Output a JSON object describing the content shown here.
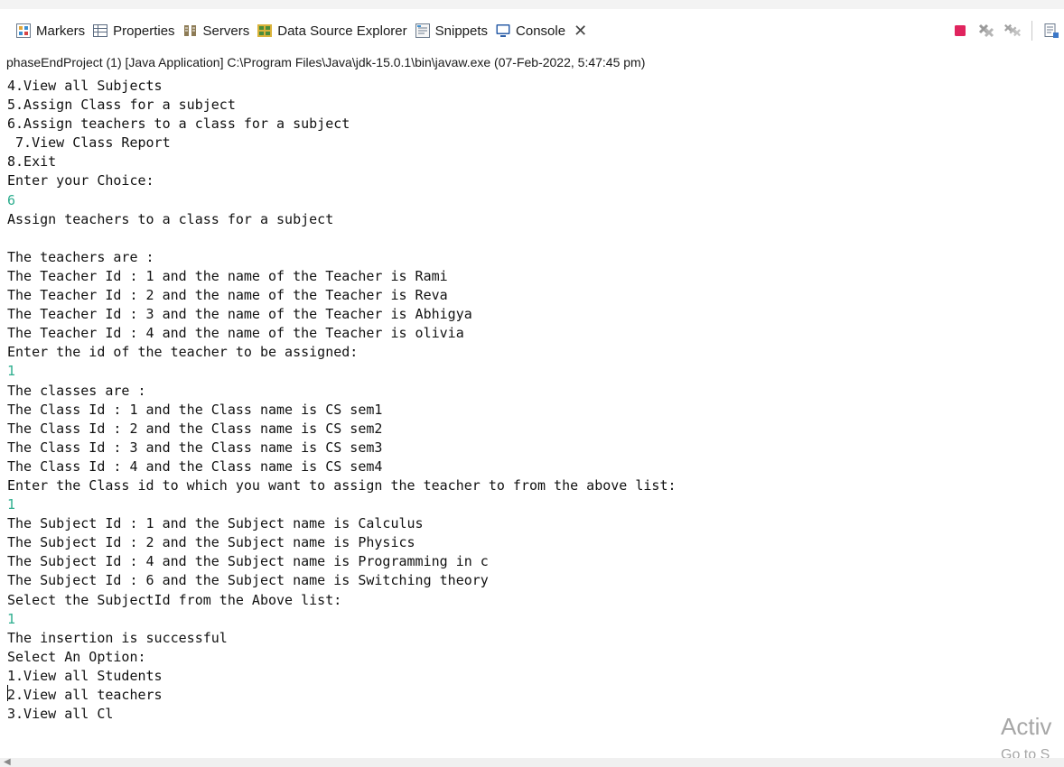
{
  "tabs": [
    {
      "id": "markers",
      "label": "Markers",
      "icon": "markers-icon"
    },
    {
      "id": "properties",
      "label": "Properties",
      "icon": "properties-icon"
    },
    {
      "id": "servers",
      "label": "Servers",
      "icon": "servers-icon"
    },
    {
      "id": "data-source-explorer",
      "label": "Data Source Explorer",
      "icon": "data-source-explorer-icon"
    },
    {
      "id": "snippets",
      "label": "Snippets",
      "icon": "snippets-icon"
    },
    {
      "id": "console",
      "label": "Console",
      "icon": "console-icon",
      "active": true
    }
  ],
  "toolbar": {
    "icons": [
      "terminate-icon",
      "remove-launch-icon",
      "remove-all-terminated-icon",
      "clear-console-icon"
    ],
    "terminate_color": "#e0245e"
  },
  "process_line": "phaseEndProject (1) [Java Application] C:\\Program Files\\Java\\jdk-15.0.1\\bin\\javaw.exe  (07-Feb-2022, 5:47:45 pm)",
  "console": {
    "input_color": "#2fae8f",
    "lines": [
      {
        "text": "4.View all Subjects",
        "type": "output"
      },
      {
        "text": "5.Assign Class for a subject",
        "type": "output"
      },
      {
        "text": "6.Assign teachers to a class for a subject",
        "type": "output"
      },
      {
        "text": " 7.View Class Report",
        "type": "output"
      },
      {
        "text": "8.Exit",
        "type": "output"
      },
      {
        "text": "Enter your Choice:",
        "type": "output"
      },
      {
        "text": "6",
        "type": "input"
      },
      {
        "text": "Assign teachers to a class for a subject",
        "type": "output"
      },
      {
        "text": "",
        "type": "output"
      },
      {
        "text": "The teachers are :",
        "type": "output"
      },
      {
        "text": "The Teacher Id : 1 and the name of the Teacher is Rami",
        "type": "output"
      },
      {
        "text": "The Teacher Id : 2 and the name of the Teacher is Reva",
        "type": "output"
      },
      {
        "text": "The Teacher Id : 3 and the name of the Teacher is Abhigya",
        "type": "output"
      },
      {
        "text": "The Teacher Id : 4 and the name of the Teacher is olivia",
        "type": "output"
      },
      {
        "text": "Enter the id of the teacher to be assigned:",
        "type": "output"
      },
      {
        "text": "1",
        "type": "input"
      },
      {
        "text": "The classes are :",
        "type": "output"
      },
      {
        "text": "The Class Id : 1 and the Class name is CS sem1",
        "type": "output"
      },
      {
        "text": "The Class Id : 2 and the Class name is CS sem2",
        "type": "output"
      },
      {
        "text": "The Class Id : 3 and the Class name is CS sem3",
        "type": "output"
      },
      {
        "text": "The Class Id : 4 and the Class name is CS sem4",
        "type": "output"
      },
      {
        "text": "Enter the Class id to which you want to assign the teacher to from the above list:",
        "type": "output"
      },
      {
        "text": "1",
        "type": "input"
      },
      {
        "text": "The Subject Id : 1 and the Subject name is Calculus",
        "type": "output"
      },
      {
        "text": "The Subject Id : 2 and the Subject name is Physics",
        "type": "output"
      },
      {
        "text": "The Subject Id : 4 and the Subject name is Programming in c",
        "type": "output"
      },
      {
        "text": "The Subject Id : 6 and the Subject name is Switching theory",
        "type": "output"
      },
      {
        "text": "Select the SubjectId from the Above list:",
        "type": "output"
      },
      {
        "text": "1",
        "type": "input"
      },
      {
        "text": "The insertion is successful",
        "type": "output"
      },
      {
        "text": "Select An Option:",
        "type": "output"
      },
      {
        "text": "1.View all Students",
        "type": "output"
      },
      {
        "text": "2.View all teachers",
        "type": "output"
      },
      {
        "text": "3.View all Cl",
        "type": "output"
      }
    ]
  },
  "watermark": {
    "title": "Activ",
    "subtitle": "Go to S"
  }
}
